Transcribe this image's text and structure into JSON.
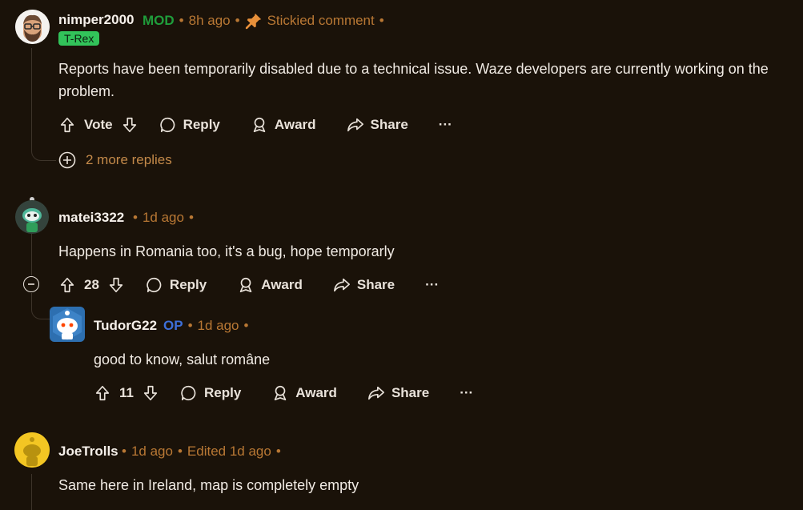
{
  "comments": [
    {
      "username": "nimper2000",
      "role": "MOD",
      "time": "8h ago",
      "stickied": "Stickied comment",
      "flair": "T-Rex",
      "body": "Reports have been temporarily disabled due to a technical issue. Waze developers are currently working on the problem.",
      "vote_label": "Vote",
      "more_replies": "2 more replies"
    },
    {
      "username": "matei3322",
      "time": "1d ago",
      "body": "Happens in Romania too, it's a bug, hope temporarly",
      "score": "28"
    },
    {
      "username": "TudorG22",
      "role": "OP",
      "time": "1d ago",
      "body": "good to know, salut române",
      "score": "11"
    },
    {
      "username": "JoeTrolls",
      "time": "1d ago",
      "edited": "Edited 1d ago",
      "body": "Same here in Ireland, map is completely empty"
    }
  ],
  "actions": {
    "reply": "Reply",
    "award": "Award",
    "share": "Share",
    "more": "···"
  },
  "separator": "•",
  "colors": {
    "background": "#1a1209",
    "meta": "#b97834",
    "mod": "#1f9d3b",
    "op": "#3d6fd9",
    "flair_bg": "#32c35a"
  }
}
